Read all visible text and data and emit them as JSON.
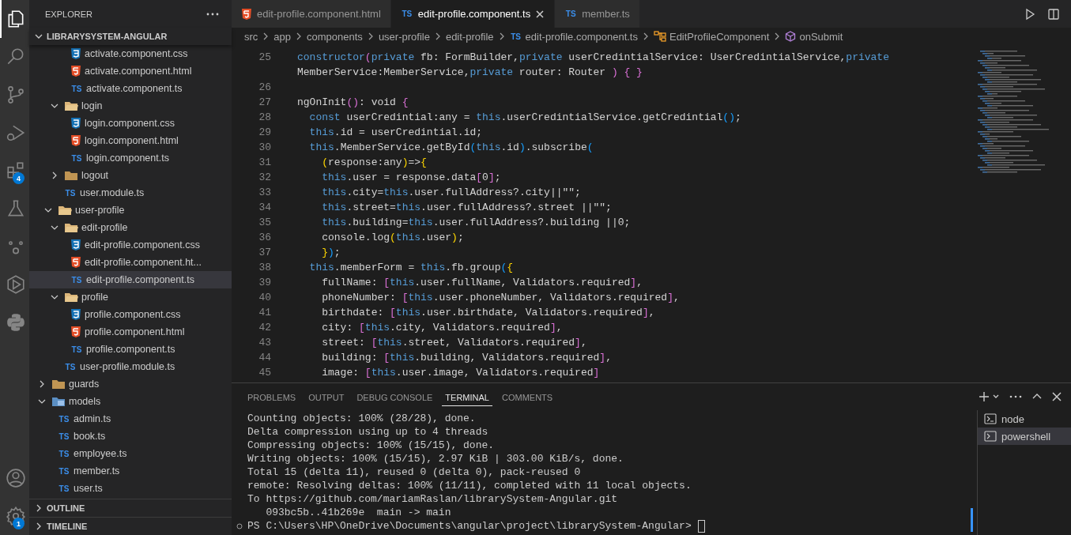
{
  "activity_bar": [
    {
      "kind": "explorer",
      "selected": true
    },
    {
      "kind": "search",
      "selected": false
    },
    {
      "kind": "source-control",
      "selected": false
    },
    {
      "kind": "run-debug",
      "selected": false
    },
    {
      "kind": "extensions",
      "selected": false,
      "badge": "4"
    },
    {
      "kind": "testing",
      "selected": false
    },
    {
      "kind": "circles",
      "selected": false
    },
    {
      "kind": "hexagon-play",
      "selected": false
    },
    {
      "kind": "snakes",
      "selected": false
    }
  ],
  "activity_bottom": [
    {
      "kind": "account",
      "selected": false
    },
    {
      "kind": "settings",
      "selected": false,
      "badge": "1"
    }
  ],
  "sidebar": {
    "title": "EXPLORER",
    "root": {
      "label": "LIBRARYSYSTEM-ANGULAR",
      "expanded": true
    },
    "tree": [
      {
        "children": [
          {
            "children": [
              {
                "children": [
                  {
                    "label": "activate.component.css",
                    "kind": "css",
                    "selected": false
                  },
                  {
                    "label": "activate.component.html",
                    "kind": "html",
                    "selected": false
                  },
                  {
                    "label": "activate.component.ts",
                    "kind": "ts",
                    "icon_text": "TS",
                    "selected": false
                  }
                ]
              },
              {
                "label": "login",
                "kind": "folder",
                "expanded": true,
                "children": [
                  {
                    "label": "login.component.css",
                    "kind": "css",
                    "selected": false
                  },
                  {
                    "label": "login.component.html",
                    "kind": "html",
                    "selected": false
                  },
                  {
                    "label": "login.component.ts",
                    "kind": "ts",
                    "icon_text": "TS",
                    "selected": false
                  }
                ]
              },
              {
                "label": "logout",
                "kind": "folder",
                "expanded": false
              },
              {
                "label": "user.module.ts",
                "kind": "ts",
                "icon_text": "TS",
                "selected": false
              }
            ]
          },
          {
            "label": "user-profile",
            "kind": "folder",
            "expanded": true,
            "children": [
              {
                "label": "edit-profile",
                "kind": "folder",
                "expanded": true,
                "children": [
                  {
                    "label": "edit-profile.component.css",
                    "kind": "css",
                    "selected": false
                  },
                  {
                    "label": "edit-profile.component.ht...",
                    "kind": "html",
                    "selected": false
                  },
                  {
                    "label": "edit-profile.component.ts",
                    "kind": "ts",
                    "icon_text": "TS",
                    "selected": true
                  }
                ]
              },
              {
                "label": "profile",
                "kind": "folder",
                "expanded": true,
                "children": [
                  {
                    "label": "profile.component.css",
                    "kind": "css",
                    "selected": false
                  },
                  {
                    "label": "profile.component.html",
                    "kind": "html",
                    "selected": false
                  },
                  {
                    "label": "profile.component.ts",
                    "kind": "ts",
                    "icon_text": "TS",
                    "selected": false
                  }
                ]
              },
              {
                "label": "user-profile.module.ts",
                "kind": "ts",
                "icon_text": "TS",
                "selected": false
              }
            ]
          }
        ]
      },
      {
        "label": "guards",
        "kind": "folder",
        "expanded": false
      },
      {
        "label": "models",
        "kind": "models-folder",
        "expanded": true,
        "children": [
          {
            "label": "admin.ts",
            "kind": "ts",
            "icon_text": "TS",
            "selected": false
          },
          {
            "label": "book.ts",
            "kind": "ts",
            "icon_text": "TS",
            "selected": false
          },
          {
            "label": "employee.ts",
            "kind": "ts",
            "icon_text": "TS",
            "selected": false
          },
          {
            "label": "member.ts",
            "kind": "ts",
            "icon_text": "TS",
            "selected": false
          },
          {
            "label": "user.ts",
            "kind": "ts",
            "icon_text": "TS",
            "selected": false
          }
        ]
      }
    ],
    "sections": [
      {
        "label": "OUTLINE",
        "expanded": false
      },
      {
        "label": "TIMELINE",
        "expanded": false
      }
    ]
  },
  "tabs": [
    {
      "label": "edit-profile.component.html",
      "kind": "html",
      "selected": false
    },
    {
      "label": "edit-profile.component.ts",
      "kind": "ts",
      "icon_text": "TS",
      "selected": true
    },
    {
      "label": "member.ts",
      "kind": "ts",
      "icon_text": "TS",
      "selected": false
    }
  ],
  "breadcrumbs": [
    {
      "label": "src",
      "kind": "folder"
    },
    {
      "label": "app",
      "kind": "folder"
    },
    {
      "label": "components",
      "kind": "folder"
    },
    {
      "label": "user-profile",
      "kind": "folder"
    },
    {
      "label": "edit-profile",
      "kind": "folder"
    },
    {
      "label": "edit-profile.component.ts",
      "kind": "ts",
      "icon_text": "TS"
    },
    {
      "label": "EditProfileComponent",
      "kind": "class"
    },
    {
      "label": "onSubmit",
      "kind": "method"
    }
  ],
  "code": [
    {
      "number": "25",
      "tokens": [
        {
          "kind": "kw",
          "text": "constructor"
        },
        {
          "kind": "b2",
          "text": "("
        },
        {
          "kind": "kw",
          "text": "private"
        },
        {
          "kind": "p",
          "text": " fb: FormBuilder,"
        },
        {
          "kind": "kw",
          "text": "private"
        },
        {
          "kind": "p",
          "text": " userCredintialService: UserCredintialService,"
        },
        {
          "kind": "kw",
          "text": "private"
        },
        {
          "kind": "p",
          "text": " MemberService:MemberService,"
        },
        {
          "kind": "kw",
          "text": "private"
        },
        {
          "kind": "p",
          "text": " router: Router "
        },
        {
          "kind": "b2",
          "text": ")"
        },
        {
          "kind": "b2",
          "text": " {"
        },
        {
          "kind": "b2",
          "text": " }"
        }
      ]
    },
    {
      "number": "26"
    },
    {
      "number": "27",
      "tokens": [
        {
          "kind": "p",
          "text": "ngOnInit"
        },
        {
          "kind": "b2",
          "text": "()"
        },
        {
          "kind": "p",
          "text": ": void "
        },
        {
          "kind": "b2",
          "text": "{"
        }
      ]
    },
    {
      "number": "28",
      "tokens": [
        {
          "kind": "kw",
          "text": "  const"
        },
        {
          "kind": "p",
          "text": " userCredintial:any = "
        },
        {
          "kind": "kw",
          "text": "this"
        },
        {
          "kind": "p",
          "text": ".userCredintialService.getCredintial"
        },
        {
          "kind": "b3",
          "text": "()"
        },
        {
          "kind": "p",
          "text": ";"
        }
      ]
    },
    {
      "number": "29",
      "tokens": [
        {
          "kind": "kw",
          "text": "  this"
        },
        {
          "kind": "p",
          "text": ".id = userCredintial.id;"
        }
      ]
    },
    {
      "number": "30",
      "tokens": [
        {
          "kind": "kw",
          "text": "  this"
        },
        {
          "kind": "p",
          "text": ".MemberService.getById"
        },
        {
          "kind": "b3",
          "text": "("
        },
        {
          "kind": "kw",
          "text": "this"
        },
        {
          "kind": "p",
          "text": ".id"
        },
        {
          "kind": "b3",
          "text": ")"
        },
        {
          "kind": "p",
          "text": ".subscribe"
        },
        {
          "kind": "b3",
          "text": "("
        }
      ]
    },
    {
      "number": "31",
      "tokens": [
        {
          "kind": "b1",
          "text": "    ("
        },
        {
          "kind": "p",
          "text": "response:any"
        },
        {
          "kind": "b1",
          "text": ")"
        },
        {
          "kind": "p",
          "text": "=>"
        },
        {
          "kind": "b1",
          "text": "{"
        }
      ]
    },
    {
      "number": "32",
      "tokens": [
        {
          "kind": "kw",
          "text": "    this"
        },
        {
          "kind": "p",
          "text": ".user = response.data"
        },
        {
          "kind": "b2",
          "text": "["
        },
        {
          "kind": "p",
          "text": "0"
        },
        {
          "kind": "b2",
          "text": "]"
        },
        {
          "kind": "p",
          "text": ";"
        }
      ]
    },
    {
      "number": "33",
      "tokens": [
        {
          "kind": "kw",
          "text": "    this"
        },
        {
          "kind": "p",
          "text": ".city="
        },
        {
          "kind": "kw",
          "text": "this"
        },
        {
          "kind": "p",
          "text": ".user.fullAddress?.city||\"\";"
        }
      ]
    },
    {
      "number": "34",
      "tokens": [
        {
          "kind": "kw",
          "text": "    this"
        },
        {
          "kind": "p",
          "text": ".street="
        },
        {
          "kind": "kw",
          "text": "this"
        },
        {
          "kind": "p",
          "text": ".user.fullAddress?.street ||\"\";"
        }
      ]
    },
    {
      "number": "35",
      "tokens": [
        {
          "kind": "kw",
          "text": "    this"
        },
        {
          "kind": "p",
          "text": ".building="
        },
        {
          "kind": "kw",
          "text": "this"
        },
        {
          "kind": "p",
          "text": ".user.fullAddress?.building ||0;"
        }
      ]
    },
    {
      "number": "36",
      "tokens": [
        {
          "kind": "p",
          "text": "    console.log"
        },
        {
          "kind": "b1",
          "text": "("
        },
        {
          "kind": "kw",
          "text": "this"
        },
        {
          "kind": "p",
          "text": ".user"
        },
        {
          "kind": "b1",
          "text": ")"
        },
        {
          "kind": "p",
          "text": ";"
        }
      ]
    },
    {
      "number": "37",
      "tokens": [
        {
          "kind": "b1",
          "text": "    }"
        },
        {
          "kind": "b3",
          "text": ")"
        },
        {
          "kind": "p",
          "text": ";"
        }
      ]
    },
    {
      "number": "38",
      "tokens": [
        {
          "kind": "kw",
          "text": "  this"
        },
        {
          "kind": "p",
          "text": ".memberForm = "
        },
        {
          "kind": "kw",
          "text": "this"
        },
        {
          "kind": "p",
          "text": ".fb.group"
        },
        {
          "kind": "b3",
          "text": "("
        },
        {
          "kind": "b1",
          "text": "{"
        }
      ]
    },
    {
      "number": "39",
      "tokens": [
        {
          "kind": "p",
          "text": "    fullName: "
        },
        {
          "kind": "b2",
          "text": "["
        },
        {
          "kind": "kw",
          "text": "this"
        },
        {
          "kind": "p",
          "text": ".user.fullName, Validators.required"
        },
        {
          "kind": "b2",
          "text": "]"
        },
        {
          "kind": "p",
          "text": ","
        }
      ]
    },
    {
      "number": "40",
      "tokens": [
        {
          "kind": "p",
          "text": "    phoneNumber: "
        },
        {
          "kind": "b2",
          "text": "["
        },
        {
          "kind": "kw",
          "text": "this"
        },
        {
          "kind": "p",
          "text": ".user.phoneNumber, Validators.required"
        },
        {
          "kind": "b2",
          "text": "]"
        },
        {
          "kind": "p",
          "text": ","
        }
      ]
    },
    {
      "number": "41",
      "tokens": [
        {
          "kind": "p",
          "text": "    birthdate: "
        },
        {
          "kind": "b2",
          "text": "["
        },
        {
          "kind": "kw",
          "text": "this"
        },
        {
          "kind": "p",
          "text": ".user.birthdate, Validators.required"
        },
        {
          "kind": "b2",
          "text": "]"
        },
        {
          "kind": "p",
          "text": ","
        }
      ]
    },
    {
      "number": "42",
      "tokens": [
        {
          "kind": "p",
          "text": "    city: "
        },
        {
          "kind": "b2",
          "text": "["
        },
        {
          "kind": "kw",
          "text": "this"
        },
        {
          "kind": "p",
          "text": ".city, Validators.required"
        },
        {
          "kind": "b2",
          "text": "]"
        },
        {
          "kind": "p",
          "text": ","
        }
      ]
    },
    {
      "number": "43",
      "tokens": [
        {
          "kind": "p",
          "text": "    street: "
        },
        {
          "kind": "b2",
          "text": "["
        },
        {
          "kind": "kw",
          "text": "this"
        },
        {
          "kind": "p",
          "text": ".street, Validators.required"
        },
        {
          "kind": "b2",
          "text": "]"
        },
        {
          "kind": "p",
          "text": ","
        }
      ]
    },
    {
      "number": "44",
      "tokens": [
        {
          "kind": "p",
          "text": "    building: "
        },
        {
          "kind": "b2",
          "text": "["
        },
        {
          "kind": "kw",
          "text": "this"
        },
        {
          "kind": "p",
          "text": ".building, Validators.required"
        },
        {
          "kind": "b2",
          "text": "]"
        },
        {
          "kind": "p",
          "text": ","
        }
      ]
    },
    {
      "number": "45",
      "tokens": [
        {
          "kind": "p",
          "text": "    image: "
        },
        {
          "kind": "b2",
          "text": "["
        },
        {
          "kind": "kw",
          "text": "this"
        },
        {
          "kind": "p",
          "text": ".user.image, Validators.required"
        },
        {
          "kind": "b2",
          "text": "]"
        }
      ]
    }
  ],
  "panel": {
    "tabs": [
      {
        "label": "PROBLEMS",
        "selected": false
      },
      {
        "label": "OUTPUT",
        "selected": false
      },
      {
        "label": "DEBUG CONSOLE",
        "selected": false
      },
      {
        "label": "TERMINAL",
        "selected": true
      },
      {
        "label": "COMMENTS",
        "selected": false
      }
    ],
    "terminal_lines": [
      "Counting objects: 100% (28/28), done.",
      "Delta compression using up to 4 threads",
      "Compressing objects: 100% (15/15), done.",
      "Writing objects: 100% (15/15), 2.97 KiB | 303.00 KiB/s, done.",
      "Total 15 (delta 11), reused 0 (delta 0), pack-reused 0",
      "remote: Resolving deltas: 100% (11/11), completed with 11 local objects.",
      "To https://github.com/mariamRaslan/librarySystem-Angular.git",
      "   093bc5b..41b269e  main -> main"
    ],
    "prompt": "PS C:\\Users\\HP\\OneDrive\\Documents\\angular\\project\\librarySystem-Angular>",
    "instances": [
      {
        "name": "node",
        "kind": "node",
        "selected": false
      },
      {
        "name": "powershell",
        "kind": "shell",
        "selected": true
      }
    ]
  }
}
